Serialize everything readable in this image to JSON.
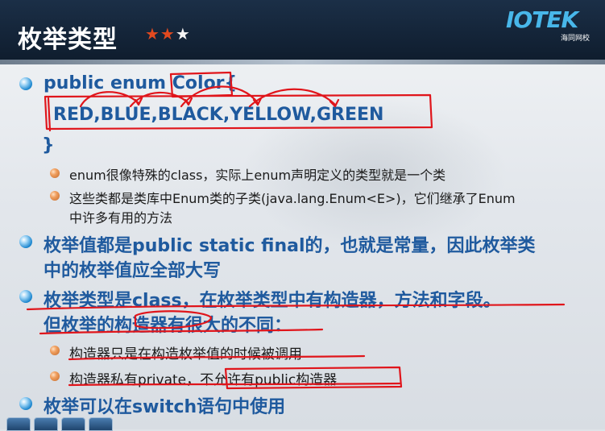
{
  "header": {
    "title": "枚举类型",
    "stars": {
      "red": "★★",
      "white": "★"
    },
    "logo": {
      "text": "IOTEK",
      "sub": "海同网校"
    }
  },
  "content": {
    "code_line1": "public enum Color{",
    "code_line2": "RED,BLUE,BLACK,YELLOW,GREEN",
    "code_line3": "}",
    "sub1": "enum很像特殊的class，实际上enum声明定义的类型就是一个类",
    "sub2_line1": "这些类都是类库中Enum类的子类(java.lang.Enum<E>)，它们继承了Enum",
    "sub2_line2": "中许多有用的方法",
    "point2_line1": "枚举值都是public static final的，也就是常量，因此枚举类",
    "point2_line2": "中的枚举值应全部大写",
    "point3_line1": "枚举类型是class，在枚举类型中有构造器，方法和字段。",
    "point3_line2": "但枚举的构造器有很大的不同：",
    "sub3": "构造器只是在构造枚举值的时候被调用",
    "sub4": "构造器私有private，不允许有public构造器",
    "point4": "枚举可以在switch语句中使用"
  },
  "colors": {
    "header_bg": "#13243a",
    "heading_text": "#1f5a9e",
    "annotation_red": "#e0151b",
    "logo_blue": "#48b7ea"
  }
}
